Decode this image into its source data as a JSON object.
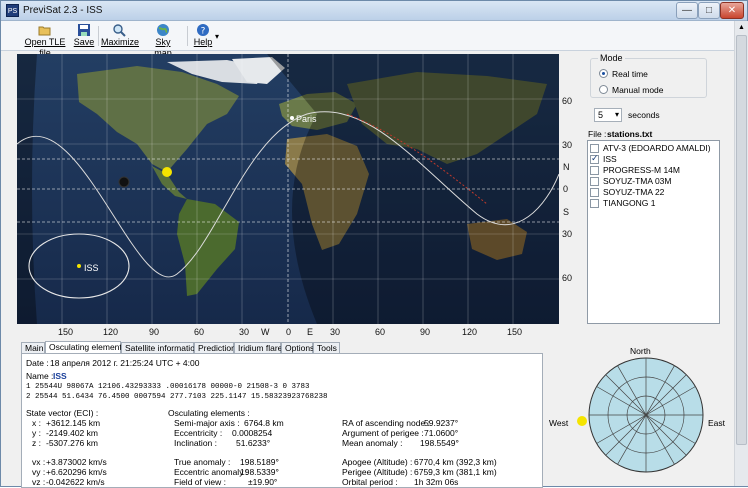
{
  "window": {
    "title": "PreviSat 2.3 - ISS",
    "icon_text": "PS",
    "min": "—",
    "max": "□",
    "close": "✕"
  },
  "toolbar": [
    {
      "label": "Open TLE file",
      "icon": "folder-open-icon"
    },
    {
      "label": "Save",
      "icon": "save-icon"
    },
    {
      "label": "Maximize",
      "icon": "magnifier-icon"
    },
    {
      "label": "Sky map",
      "icon": "globe-icon"
    },
    {
      "label": "Help",
      "icon": "help-icon"
    }
  ],
  "map": {
    "lat_labels": [
      "60",
      "30",
      "N",
      "0",
      "S",
      "30",
      "60"
    ],
    "lon_labels": [
      "150",
      "120",
      "90",
      "60",
      "30",
      "W",
      "0",
      "E",
      "30",
      "60",
      "90",
      "120",
      "150"
    ],
    "city": "Paris",
    "sat_label": "ISS"
  },
  "mode": {
    "title": "Mode",
    "real_time": "Real time",
    "manual": "Manual mode"
  },
  "seconds": {
    "value": "5",
    "unit": "seconds"
  },
  "file": {
    "label": "File :",
    "name": "stations.txt"
  },
  "satellites": [
    {
      "name": "ATV-3 (EDOARDO AMALDI)",
      "checked": false
    },
    {
      "name": "ISS",
      "checked": true
    },
    {
      "name": "PROGRESS-M 14M",
      "checked": false
    },
    {
      "name": "SOYUZ-TMA 03M",
      "checked": false
    },
    {
      "name": "SOYUZ-TMA 22",
      "checked": false
    },
    {
      "name": "TIANGONG 1",
      "checked": false
    }
  ],
  "tabs": [
    "Main",
    "Osculating elements",
    "Satellite informations",
    "Predictions",
    "Iridium flares",
    "Options",
    "Tools"
  ],
  "panel": {
    "date_label": "Date :",
    "date": "18 апреля 2012 г.  21:25:24  UTC + 4:00",
    "name_label": "Name :",
    "name": "ISS",
    "tle1": "1 25544U 98067A   12106.43293333  .00016178  00000-0  21508-3 0  3783",
    "tle2": "2 25544  51.6434  76.4500 0007594 277.7103 225.1147 15.58323923768238",
    "state_title": "State vector (ECI) :",
    "state": [
      [
        "x :",
        "+3612.145 km"
      ],
      [
        "y :",
        "-2149.402 km"
      ],
      [
        "z :",
        "-5307.276 km"
      ],
      [
        "vx :",
        "+3.873002 km/s"
      ],
      [
        "vy :",
        "+6.620296 km/s"
      ],
      [
        "vz :",
        "-0.042622 km/s"
      ]
    ],
    "osc_title": "Osculating elements :",
    "osc": [
      [
        "Semi-major axis :",
        "6764.8 km"
      ],
      [
        "Eccentricity :",
        "0.0008254"
      ],
      [
        "Inclination :",
        "51.6233°"
      ],
      [
        "True anomaly :",
        "198.5189°"
      ],
      [
        "Eccentric anomaly :",
        "198.5339°"
      ],
      [
        "Field of view :",
        "±19.90°"
      ]
    ],
    "orb": [
      [
        "RA of ascending node :",
        "59.9237°"
      ],
      [
        "Argument of perigee :",
        "71.0600°"
      ],
      [
        "Mean anomaly :",
        "198.5549°"
      ],
      [
        "Apogee (Altitude) :",
        "6770,4 km (392,3 km)"
      ],
      [
        "Perigee (Altitude) :",
        "6759,3 km (381,1 km)"
      ],
      [
        "Orbital period :",
        "1h 32m 06s"
      ]
    ]
  },
  "sky": {
    "north": "North",
    "west": "West",
    "east": "East"
  },
  "colors": {
    "sky_fill": "#b8dde8",
    "sun": "#f5e400",
    "ocean": "#1a3556",
    "land": "#4f6b3a"
  }
}
